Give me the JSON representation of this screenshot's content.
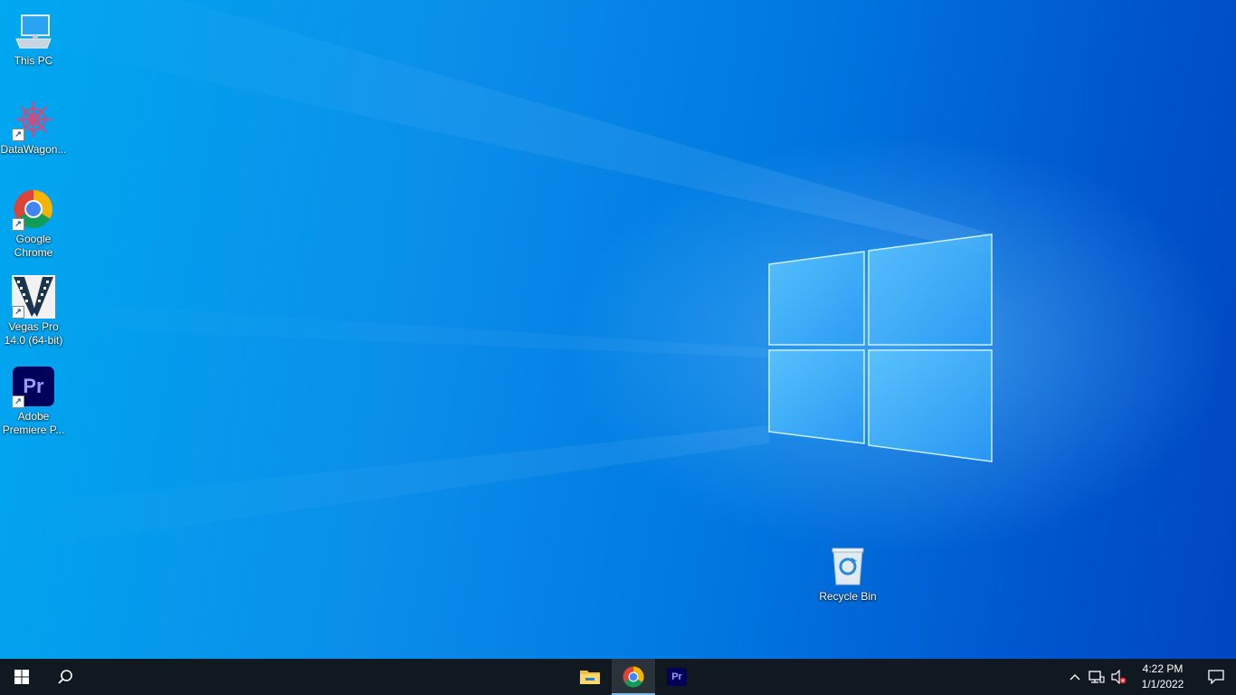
{
  "desktop": {
    "icons": [
      {
        "label": "This PC",
        "icon": "this-pc-icon"
      },
      {
        "label": "DataWagon...",
        "icon": "datawagon-icon"
      },
      {
        "label": "Google Chrome",
        "icon": "chrome-icon"
      },
      {
        "label": "Vegas Pro 14.0 (64-bit)",
        "icon": "vegas-pro-icon"
      },
      {
        "label": "Adobe Premiere P...",
        "icon": "premiere-pro-icon"
      },
      {
        "label": "Recycle Bin",
        "icon": "recycle-bin-icon"
      }
    ],
    "premiere_glyph": "Pr"
  },
  "taskbar": {
    "pinned": [
      {
        "name": "File Explorer",
        "icon": "file-explorer-icon"
      },
      {
        "name": "Google Chrome",
        "icon": "chrome-icon",
        "active": true
      },
      {
        "name": "Adobe Premiere Pro",
        "icon": "premiere-pro-icon",
        "glyph": "Pr"
      }
    ],
    "clock": {
      "time": "4:22 PM",
      "date": "1/1/2022"
    }
  },
  "colors": {
    "taskbar_bg": "#101820",
    "premiere_bg": "#00005b",
    "premiere_fg": "#9999ff",
    "active_indicator": "#76b9ed"
  }
}
